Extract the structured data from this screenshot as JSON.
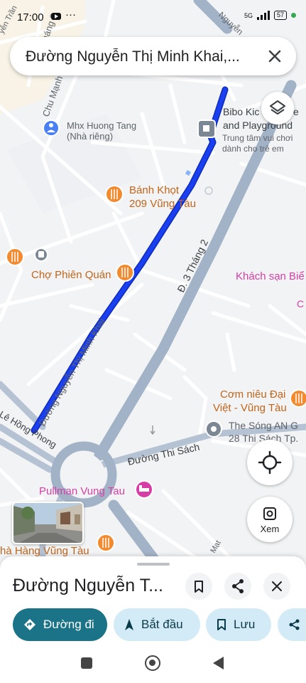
{
  "status_bar": {
    "time": "17:00",
    "network": "5G",
    "battery": "57"
  },
  "search": {
    "query": "Đường Nguyễn Thị Minh Khai,..."
  },
  "map": {
    "place_labels": {
      "hotel_huong_tang": "Mhx Huong Tang",
      "hotel_huong_tang_sub": "(Nhà riêng)",
      "banh_khot_1": "Bánh Khọt",
      "banh_khot_2": "209 Vũng Tàu",
      "cho_phien_quan": "Chợ Phiên Quán",
      "bibo_1": "Bibo Kic",
      "bibo_1b": "e",
      "bibo_2": "and Playground",
      "bibo_3": "Trung tâm vui chơi",
      "bibo_4": "dành cho trẻ em",
      "khach_san": "Khách sạn Biể",
      "com_nieu_1": "Cơm niêu Đại",
      "com_nieu_2": "Việt - Vũng Tàu",
      "the_song_1": "The Sóng AN G",
      "the_song_2": "28 Thi Sách Tp.",
      "pullman": "Pullman Vung Tau",
      "nha_hang": "hà Hàng Vũng Tàu"
    },
    "street_labels": {
      "nguyen_thi_minh_khai": "Đường Nguyễn Thị Minh Khai",
      "ba_thang_hai": "Đ. 3 Tháng 2",
      "thi_sach": "Đường Thi Sách",
      "le_hong_phong": "Lê Hồng Phong",
      "chu_manh": "Chu Mạnh",
      "thang_9": "Tháng 9",
      "nguyen_top": "Nguyễn",
      "tran": "yễn Trần",
      "c_edge": "C",
      "mat": "Mạt"
    },
    "colors": {
      "route": "#1a3ff0",
      "major_road": "#a3b3c7",
      "poi_food": "#f28b30",
      "poi_hotel": "#d63ea5",
      "poi_gray": "#7b8794",
      "poi_blue": "#4a80f5"
    }
  },
  "controls": {
    "xem_label": "Xem"
  },
  "sheet": {
    "title": "Đường Nguyễn T...",
    "chips": {
      "directions": "Đường đi",
      "start": "Bắt đầu",
      "save": "Lưu"
    }
  }
}
